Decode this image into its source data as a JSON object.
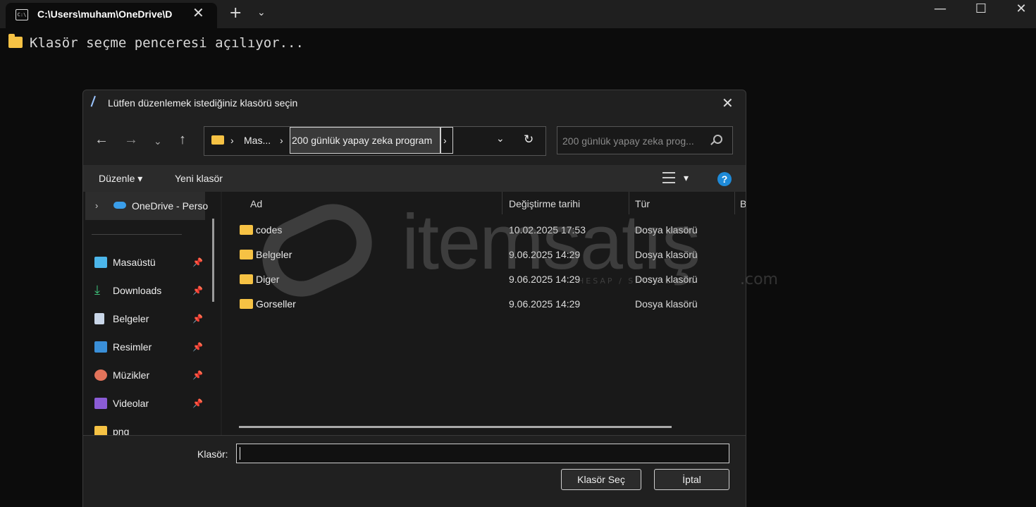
{
  "terminal": {
    "tab_title": "C:\\Users\\muham\\OneDrive\\D",
    "output_line": "Klasör seçme penceresi açılıyor..."
  },
  "dialog": {
    "title": "Lütfen düzenlemek istediğiniz klasörü seçin",
    "breadcrumb": [
      "Mas...",
      "200 günlük yapay zeka program"
    ],
    "search_placeholder": "200 günlük yapay zeka prog...",
    "toolbar": {
      "organize": "Düzenle",
      "new_folder": "Yeni klasör"
    },
    "nav": {
      "onedrive": "OneDrive - Perso",
      "items": [
        "Masaüstü",
        "Downloads",
        "Belgeler",
        "Resimler",
        "Müzikler",
        "Videolar",
        "png"
      ]
    },
    "columns": {
      "name": "Ad",
      "modified": "Değiştirme tarihi",
      "type": "Tür",
      "size": "B"
    },
    "files": [
      {
        "name": "codes",
        "date": "10.02.2025 17:53",
        "type": "Dosya klasörü"
      },
      {
        "name": "Belgeler",
        "date": "9.06.2025 14:29",
        "type": "Dosya klasörü"
      },
      {
        "name": "Diger",
        "date": "9.06.2025 14:29",
        "type": "Dosya klasörü"
      },
      {
        "name": "Gorseller",
        "date": "9.06.2025 14:29",
        "type": "Dosya klasörü"
      }
    ],
    "folder_label": "Klasör:",
    "folder_value": "",
    "select_button": "Klasör Seç",
    "cancel_button": "İptal"
  },
  "watermark": {
    "brand": "itemsatış",
    "tagline": "HESAP / SATIŞ E-PIN",
    "tld": ".com"
  }
}
